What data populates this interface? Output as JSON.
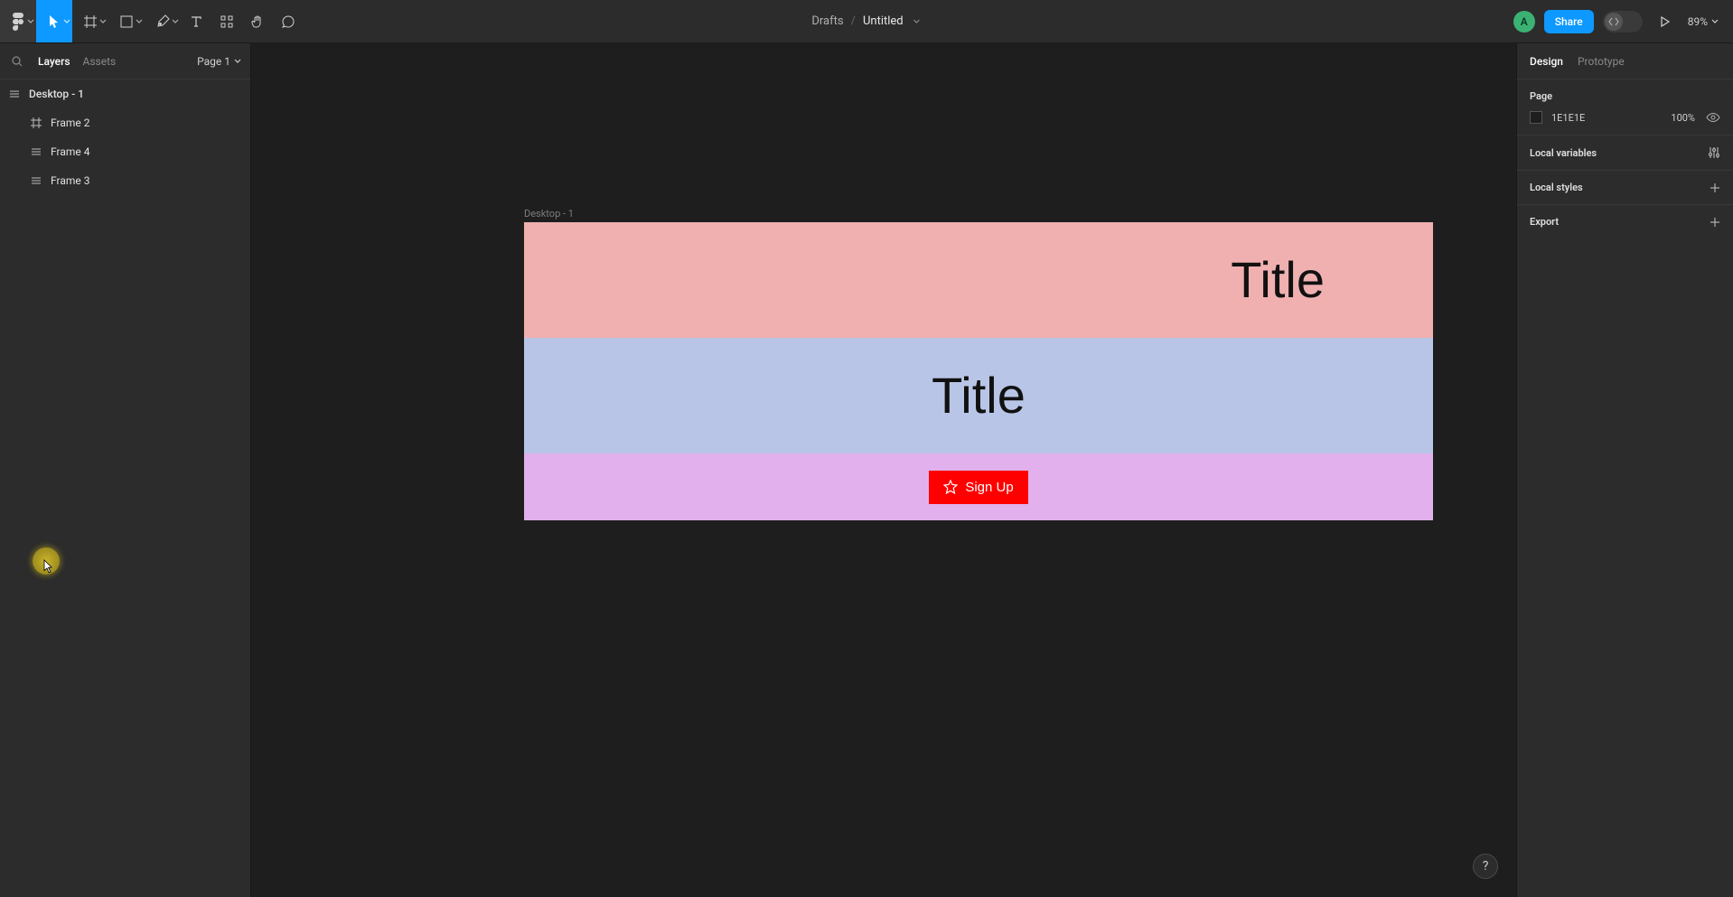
{
  "toolbar": {
    "location": "Drafts",
    "slash": "/",
    "filename": "Untitled",
    "avatar_letter": "A",
    "share_label": "Share",
    "zoom_label": "89%"
  },
  "left_panel": {
    "tabs": {
      "layers": "Layers",
      "assets": "Assets"
    },
    "page_selector": "Page 1",
    "layers": [
      {
        "name": "Desktop - 1",
        "top": true
      },
      {
        "name": "Frame 2",
        "child": true,
        "icon": "frame"
      },
      {
        "name": "Frame 4",
        "child": true,
        "icon": "autolayout"
      },
      {
        "name": "Frame 3",
        "child": true,
        "icon": "autolayout"
      }
    ]
  },
  "canvas": {
    "frame_label": "Desktop - 1",
    "section_pink_title": "Title",
    "section_blue_title": "Title",
    "signup_label": "Sign Up"
  },
  "right_panel": {
    "tabs": {
      "design": "Design",
      "prototype": "Prototype"
    },
    "page_section_title": "Page",
    "page_color_hex": "1E1E1E",
    "page_color_opacity": "100%",
    "local_variables_title": "Local variables",
    "local_styles_title": "Local styles",
    "export_title": "Export"
  },
  "help_label": "?"
}
